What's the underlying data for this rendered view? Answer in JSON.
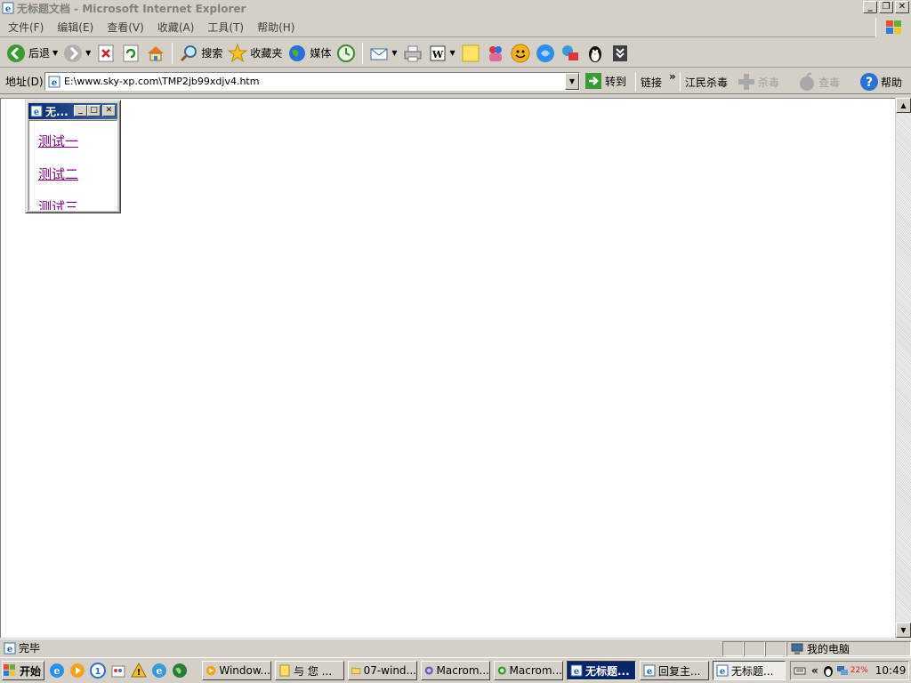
{
  "window": {
    "title": "无标题文档 - Microsoft Internet Explorer",
    "icon": "ie-icon"
  },
  "menu": {
    "items": [
      "文件(F)",
      "编辑(E)",
      "查看(V)",
      "收藏(A)",
      "工具(T)",
      "帮助(H)"
    ]
  },
  "toolbar": {
    "back_label": "后退",
    "search_label": "搜索",
    "favorites_label": "收藏夹",
    "media_label": "媒体"
  },
  "addressbar": {
    "label": "地址(D)",
    "url": "E:\\www.sky-xp.com\\TMP2jb99xdjv4.htm",
    "go_label": "转到",
    "links_label": "链接",
    "links_chevron": "»",
    "jiangmin_label": "江民杀毒",
    "kill_label": "杀毒",
    "scan_label": "查毒",
    "help_label": "帮助"
  },
  "popup": {
    "title": "无...",
    "links": [
      "测试一",
      "测试二",
      "测试三"
    ],
    "link_color": "#800080"
  },
  "statusbar": {
    "text": "完毕",
    "zone": "我的电脑"
  },
  "taskbar": {
    "start_label": "开始",
    "tasks": [
      {
        "label": "Window..."
      },
      {
        "label": "与 您 ..."
      },
      {
        "label": "07-wind..."
      },
      {
        "label": "Macrom..."
      },
      {
        "label": "Macrom..."
      },
      {
        "label": "无标题..."
      },
      {
        "label": "回复主..."
      },
      {
        "label": "无标题..."
      }
    ],
    "tray_chevron": "«",
    "tray_percent": "22%",
    "clock": "10:49"
  },
  "colors": {
    "accent": "#0a246a",
    "face": "#d4d0c8"
  }
}
